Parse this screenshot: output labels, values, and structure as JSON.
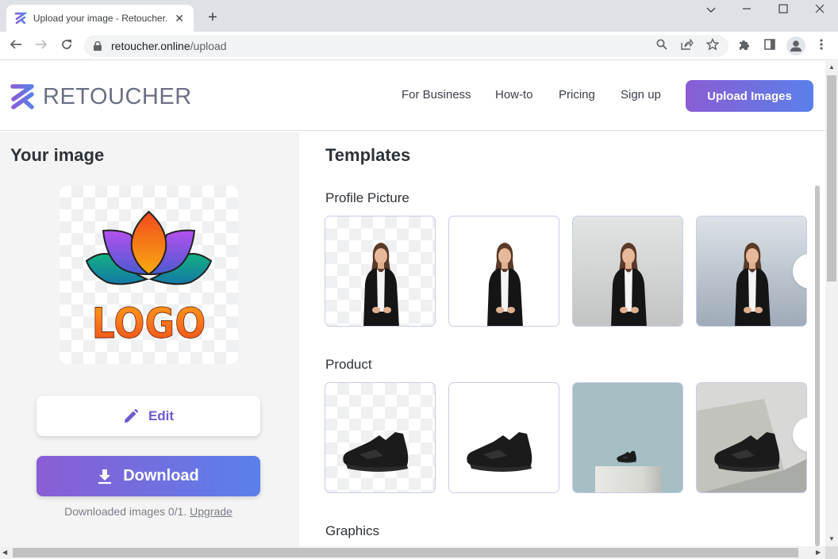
{
  "browser": {
    "tab_title": "Upload your image - Retoucher.Online",
    "new_tab_label": "+",
    "url_domain": "retoucher.online",
    "url_path": "/upload",
    "icons": [
      "back-arrow-icon",
      "forward-arrow-icon",
      "reload-icon",
      "lock-icon",
      "search-icon",
      "share-icon",
      "star-icon",
      "extensions-icon",
      "side-panel-icon",
      "profile-icon",
      "menu-icon"
    ]
  },
  "header": {
    "brand": "RETOUCHER",
    "nav": [
      "For Business",
      "How-to",
      "Pricing",
      "Sign up"
    ],
    "cta": "Upload Images"
  },
  "left": {
    "title": "Your image",
    "preview_text": "LOGO",
    "edit_label": "Edit",
    "download_label": "Download",
    "download_note": "Downloaded images 0/1.",
    "upgrade_label": "Upgrade"
  },
  "right": {
    "title": "Templates",
    "sections": [
      {
        "title": "Profile Picture",
        "cards": [
          "transparent",
          "white",
          "gray-gradient",
          "blue-gray-gradient"
        ]
      },
      {
        "title": "Product",
        "cards": [
          "transparent",
          "white",
          "teal-pedestal",
          "gray-geometric"
        ]
      },
      {
        "title": "Graphics"
      }
    ]
  },
  "colors": {
    "brand_gradient_start": "#8a5dd4",
    "brand_gradient_end": "#5a80ea",
    "edit_text": "#7059d0"
  }
}
